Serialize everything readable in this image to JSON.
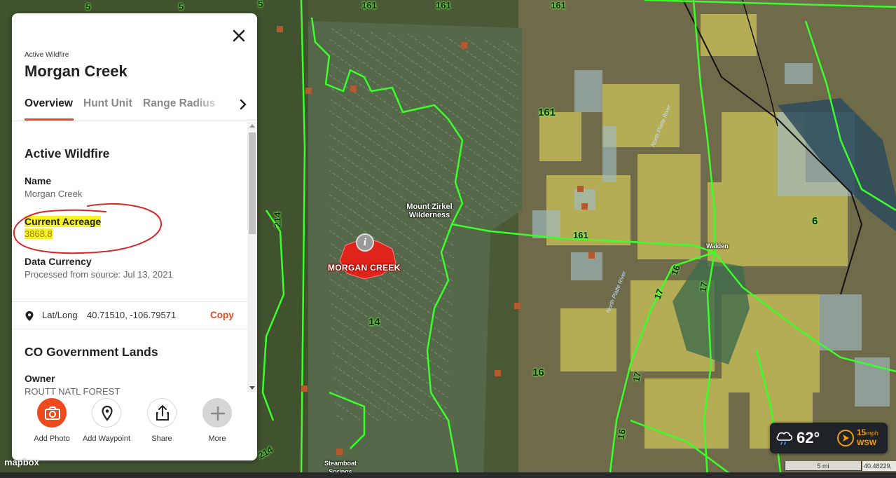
{
  "panel": {
    "eyebrow": "Active Wildfire",
    "title": "Morgan Creek",
    "tabs": [
      {
        "label": "Overview",
        "active": true
      },
      {
        "label": "Hunt Unit",
        "active": false
      },
      {
        "label": "Range Radius",
        "active": false
      }
    ],
    "sections": {
      "wildfire": {
        "title": "Active Wildfire",
        "name_label": "Name",
        "name_value": "Morgan Creek",
        "acreage_label": "Current Acreage",
        "acreage_value": "3868.8",
        "currency_label": "Data Currency",
        "currency_value": "Processed from source: Jul 13, 2021"
      },
      "latlong": {
        "label": "Lat/Long",
        "value": "40.71510, -106.79571",
        "copy_label": "Copy"
      },
      "lands": {
        "title": "CO Government Lands",
        "owner_label": "Owner",
        "owner_value": "ROUTT NATL FOREST"
      }
    },
    "actions": [
      {
        "label": "Add Photo",
        "icon": "camera-icon"
      },
      {
        "label": "Add Waypoint",
        "icon": "map-pin-icon"
      },
      {
        "label": "Share",
        "icon": "share-icon"
      },
      {
        "label": "More",
        "icon": "plus-icon"
      }
    ]
  },
  "map": {
    "fire_label": "MORGAN CREEK",
    "wilderness_label": "Mount Zirkel Wilderness",
    "town_label": "Walden",
    "steamboat_label": "Steamboat Springs",
    "river_label_1": "North Platte River",
    "river_label_2": "North Platte River",
    "unit_labels": [
      "5",
      "5",
      "5",
      "161",
      "161",
      "161",
      "14",
      "14",
      "16",
      "16",
      "17",
      "17",
      "6",
      "6",
      "214",
      "214",
      "17",
      "16"
    ],
    "attribution": "mapbox",
    "scale": "5 mi",
    "coords": "40.48229,"
  },
  "weather": {
    "temp": "62°",
    "wind_speed": "15",
    "wind_unit": "mph",
    "wind_dir": "WSW",
    "condition_icon": "rain-cloud-icon"
  },
  "colors": {
    "accent": "#ef4a1e",
    "unit_boundary": "#3aff2a",
    "fire_fill": "#e0241b",
    "highlight": "#f6f226",
    "annotation": "#d9262a"
  }
}
